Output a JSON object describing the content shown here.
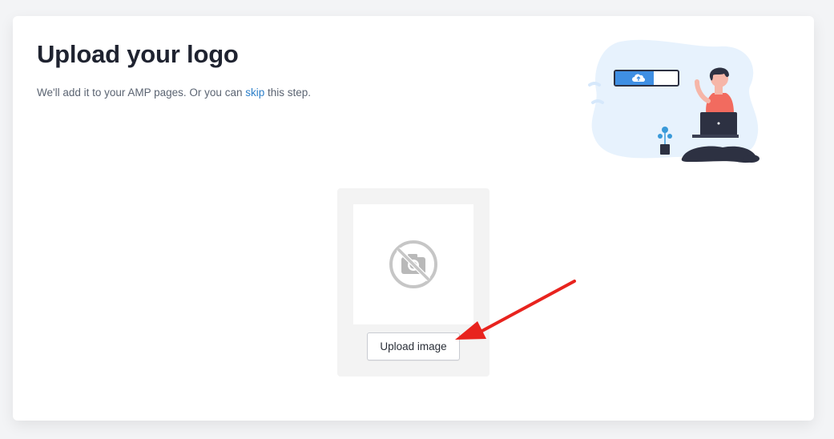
{
  "page": {
    "title": "Upload your logo",
    "subtitle": {
      "prefix": "We'll add it to your AMP pages. Or you can ",
      "link": "skip",
      "suffix": " this step."
    }
  },
  "uploader": {
    "preview_icon": "no-camera-icon",
    "button_label": "Upload image"
  },
  "illustration": {
    "name": "person-uploading-illustration",
    "icon": "cloud-upload-icon"
  },
  "annotation": {
    "type": "red-arrow",
    "color": "#e8231e",
    "target": "upload-image-button"
  },
  "colors": {
    "link": "#2c7fc9",
    "accent": "#3f8fe3",
    "shirt": "#f26b5f"
  }
}
